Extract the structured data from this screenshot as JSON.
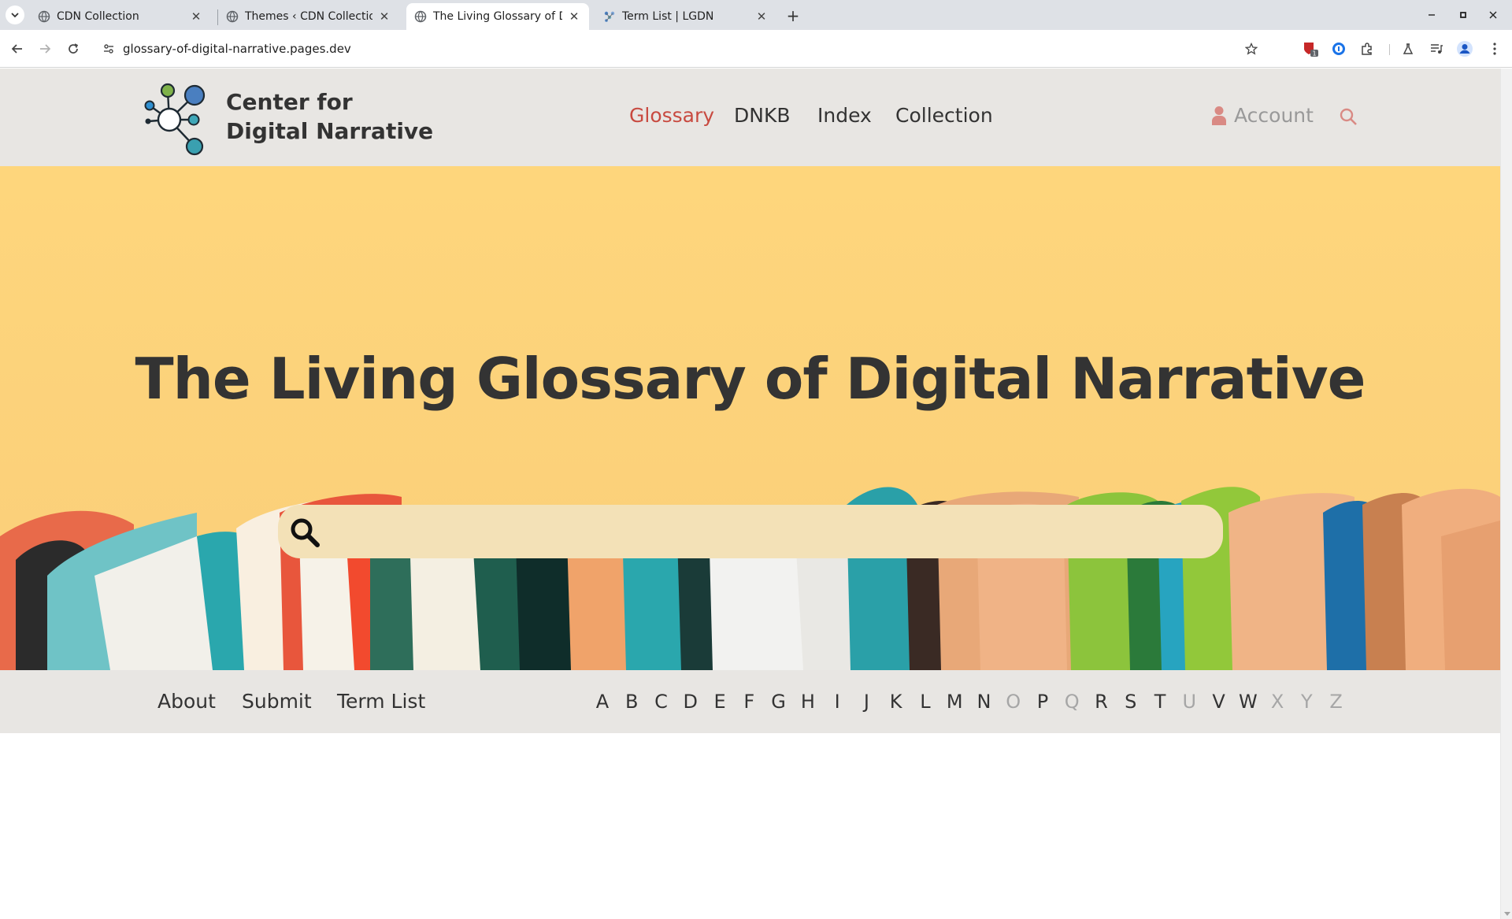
{
  "browser": {
    "tabs": [
      {
        "title": "CDN Collection",
        "active": false
      },
      {
        "title": "Themes ‹ CDN Collection",
        "active": false
      },
      {
        "title": "The Living Glossary of Dig",
        "active": true
      },
      {
        "title": "Term List | LGDN",
        "active": false
      }
    ],
    "url": "glossary-of-digital-narrative.pages.dev",
    "extension_badge": "1"
  },
  "site": {
    "logo_line1": "Center for",
    "logo_line2": "Digital Narrative",
    "nav": [
      "Glossary",
      "DNKB",
      "Index",
      "Collection"
    ],
    "active_nav": "Glossary",
    "account_label": "Account"
  },
  "hero": {
    "title": "The Living Glossary of Digital Narrative",
    "search_value": ""
  },
  "subnav": {
    "links": [
      "About",
      "Submit",
      "Term List"
    ],
    "letters": [
      {
        "l": "A",
        "on": true
      },
      {
        "l": "B",
        "on": true
      },
      {
        "l": "C",
        "on": true
      },
      {
        "l": "D",
        "on": true
      },
      {
        "l": "E",
        "on": true
      },
      {
        "l": "F",
        "on": true
      },
      {
        "l": "G",
        "on": true
      },
      {
        "l": "H",
        "on": true
      },
      {
        "l": "I",
        "on": true
      },
      {
        "l": "J",
        "on": true
      },
      {
        "l": "K",
        "on": true
      },
      {
        "l": "L",
        "on": true
      },
      {
        "l": "M",
        "on": true
      },
      {
        "l": "N",
        "on": true
      },
      {
        "l": "O",
        "on": false
      },
      {
        "l": "P",
        "on": true
      },
      {
        "l": "Q",
        "on": false
      },
      {
        "l": "R",
        "on": true
      },
      {
        "l": "S",
        "on": true
      },
      {
        "l": "T",
        "on": true
      },
      {
        "l": "U",
        "on": false
      },
      {
        "l": "V",
        "on": true
      },
      {
        "l": "W",
        "on": true
      },
      {
        "l": "X",
        "on": false
      },
      {
        "l": "Y",
        "on": false
      },
      {
        "l": "Z",
        "on": false
      }
    ]
  },
  "colors": {
    "accent": "#c84a40",
    "header_bg": "#e8e6e3",
    "hero_bg": "#fdd77e",
    "text": "#333333",
    "disabled_letter": "#a6a6a6"
  },
  "icons": [
    "tab-search-icon",
    "globe-icon",
    "close-icon",
    "plus-icon",
    "minimize-icon",
    "maximize-icon",
    "back-arrow-icon",
    "forward-arrow-icon",
    "reload-icon",
    "site-info-icon",
    "bookmark-star-icon",
    "extension-shield-icon",
    "password-manager-icon",
    "puzzle-icon",
    "labs-flask-icon",
    "media-list-icon",
    "profile-avatar-icon",
    "kebab-menu-icon",
    "logo-network-icon",
    "person-icon",
    "search-icon",
    "magnifier-icon"
  ]
}
